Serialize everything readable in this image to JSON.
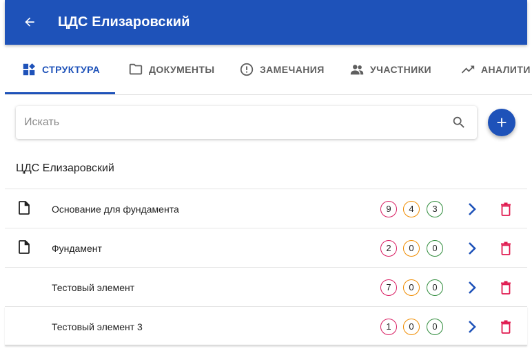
{
  "appbar": {
    "title": "ЦДС Елизаровский",
    "back_icon": "arrow-back-icon"
  },
  "tabs": [
    {
      "label": "СТРУКТУРА",
      "icon": "dashboard-icon",
      "active": true
    },
    {
      "label": "ДОКУМЕНТЫ",
      "icon": "folder-icon",
      "active": false
    },
    {
      "label": "ЗАМЕЧАНИЯ",
      "icon": "alert-circle-icon",
      "active": false
    },
    {
      "label": "УЧАСТНИКИ",
      "icon": "people-icon",
      "active": false
    },
    {
      "label": "АНАЛИТИ",
      "icon": "trending-up-icon",
      "active": false
    }
  ],
  "search": {
    "placeholder": "Искать",
    "value": ""
  },
  "section": {
    "title": "ЦДС Елизаровский"
  },
  "colors": {
    "primary": "#1e52b9",
    "red": "#d81b60",
    "orange": "#f08c00",
    "green": "#2e8b3a",
    "delete": "#e0194f"
  },
  "rows": [
    {
      "label": "Основание для фундамента",
      "has_file_icon": true,
      "counts": [
        "9",
        "4",
        "3"
      ]
    },
    {
      "label": "Фундамент",
      "has_file_icon": true,
      "counts": [
        "2",
        "0",
        "0"
      ]
    },
    {
      "label": "Тестовый элемент",
      "has_file_icon": false,
      "counts": [
        "7",
        "0",
        "0"
      ]
    },
    {
      "label": "Тестовый элемент 3",
      "has_file_icon": false,
      "counts": [
        "1",
        "0",
        "0"
      ]
    }
  ]
}
